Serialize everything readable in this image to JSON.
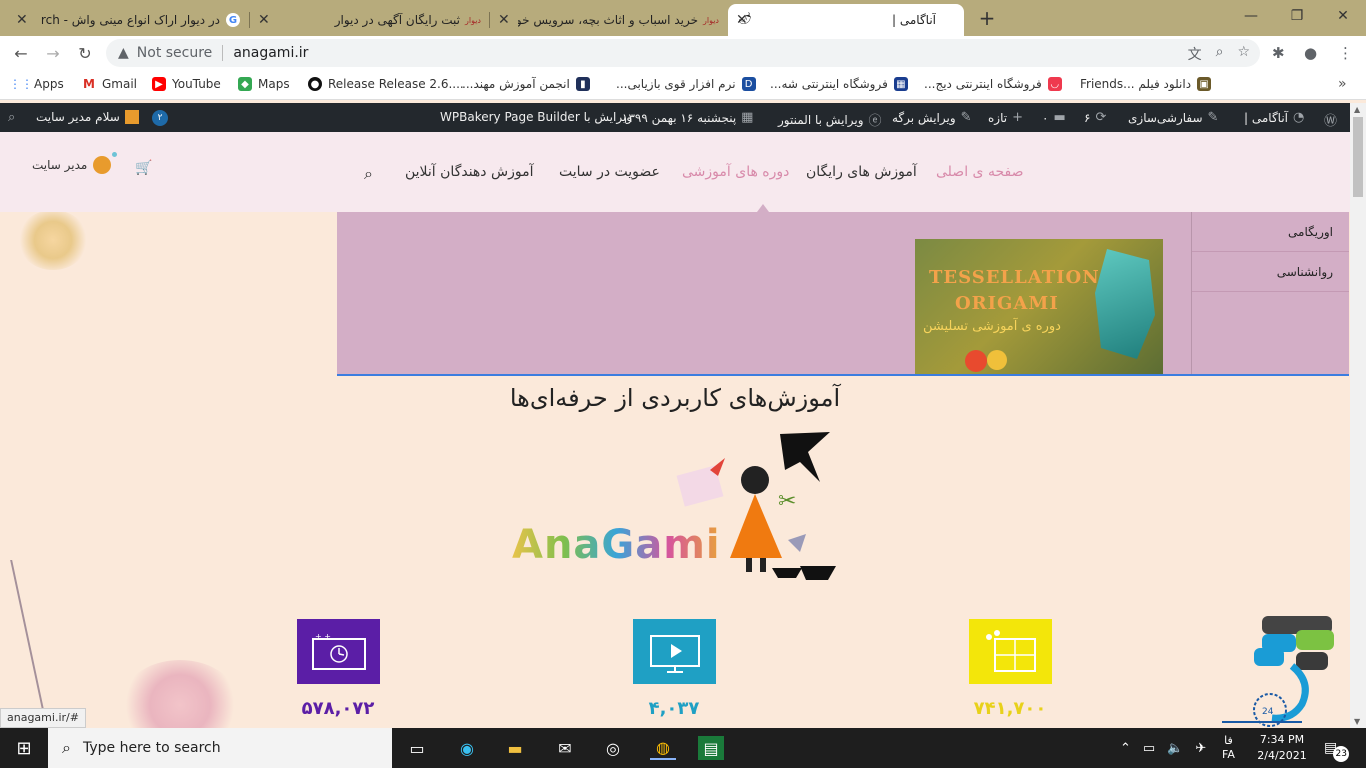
{
  "browser": {
    "tabs": [
      {
        "title": "در دیوار اراک انواع مینی واش - rch",
        "fav": "G"
      },
      {
        "title": "ثبت رایگان آگهی در دیوار",
        "fav": "دیوار"
      },
      {
        "title": "خرید اسباب و اثاث بچه، سرویس خو",
        "fav": "دیوار"
      },
      {
        "title": "آناگامی |",
        "fav": "🌶"
      }
    ],
    "new_tab": "+",
    "win_min": "—",
    "win_max": "❐",
    "win_close": "✕",
    "security": "Not secure",
    "url": "anagami.ir"
  },
  "bookmarks": [
    {
      "label": "Apps",
      "icon": "grid-icon"
    },
    {
      "label": "Gmail",
      "icon": "gmail-icon"
    },
    {
      "label": "YouTube",
      "icon": "youtube-icon"
    },
    {
      "label": "Maps",
      "icon": "maps-icon"
    },
    {
      "label": "Release Release 2.6....",
      "icon": "github-icon"
    },
    {
      "label": "انجمن آموزش مهند...",
      "icon": "forum-icon"
    },
    {
      "label": "نرم افزار قوی بازیابی...",
      "icon": "recovery-icon"
    },
    {
      "label": "فروشگاه اینترنتی شه...",
      "icon": "shop-icon"
    },
    {
      "label": "فروشگاه اینترنتی دیج...",
      "icon": "digikala-icon"
    },
    {
      "label": "دانلود فیلم ...Friends",
      "icon": "film-icon"
    }
  ],
  "wpbar": {
    "site": "آناگامی |",
    "customize": "سفارشی‌سازی",
    "updates": "۶",
    "comments": "۰",
    "new": "تازه",
    "edit_page": "ویرایش برگه",
    "edit_elementor": "ویرایش با المنتور",
    "date": "پنجشنبه ۱۶ بهمن ۱۳۹۹",
    "wpbakery": "ویرایش با WPBakery Page Builder",
    "badge": "۲",
    "greeting": "سلام مدیر سایت"
  },
  "nav": {
    "home": "صفحه ی اصلی",
    "free": "آموزش های رایگان",
    "courses": "دوره های آموزشی",
    "membership": "عضویت در سایت",
    "instructors": "آموزش دهندگان آنلاین",
    "user": "مدیر سایت"
  },
  "mega": {
    "items": [
      "اوریگامی",
      "روانشناسی"
    ],
    "promo_line1": "TESSELLATION",
    "promo_line2": "ORIGAMI",
    "promo_line3": "دوره ی آموزشی تسلیشن"
  },
  "hero": {
    "title": "آموزش‌های کاربردی از حرفه‌ای‌ها",
    "logo_text": "AnaGami"
  },
  "stats": [
    {
      "value": "۵۷۸,۰۷۲",
      "color": "#5b1ea6"
    },
    {
      "value": "۴,۰۳۷",
      "color": "#1fa0c4"
    },
    {
      "value": "۷۴۱,۷۰۰",
      "color": "#e8d11a"
    }
  ],
  "status_url": "anagami.ir/#",
  "taskbar": {
    "search_placeholder": "Type here to search",
    "lang1": "فا",
    "lang2": "FA",
    "time": "7:34 PM",
    "date": "2/4/2021",
    "notif": "23"
  }
}
